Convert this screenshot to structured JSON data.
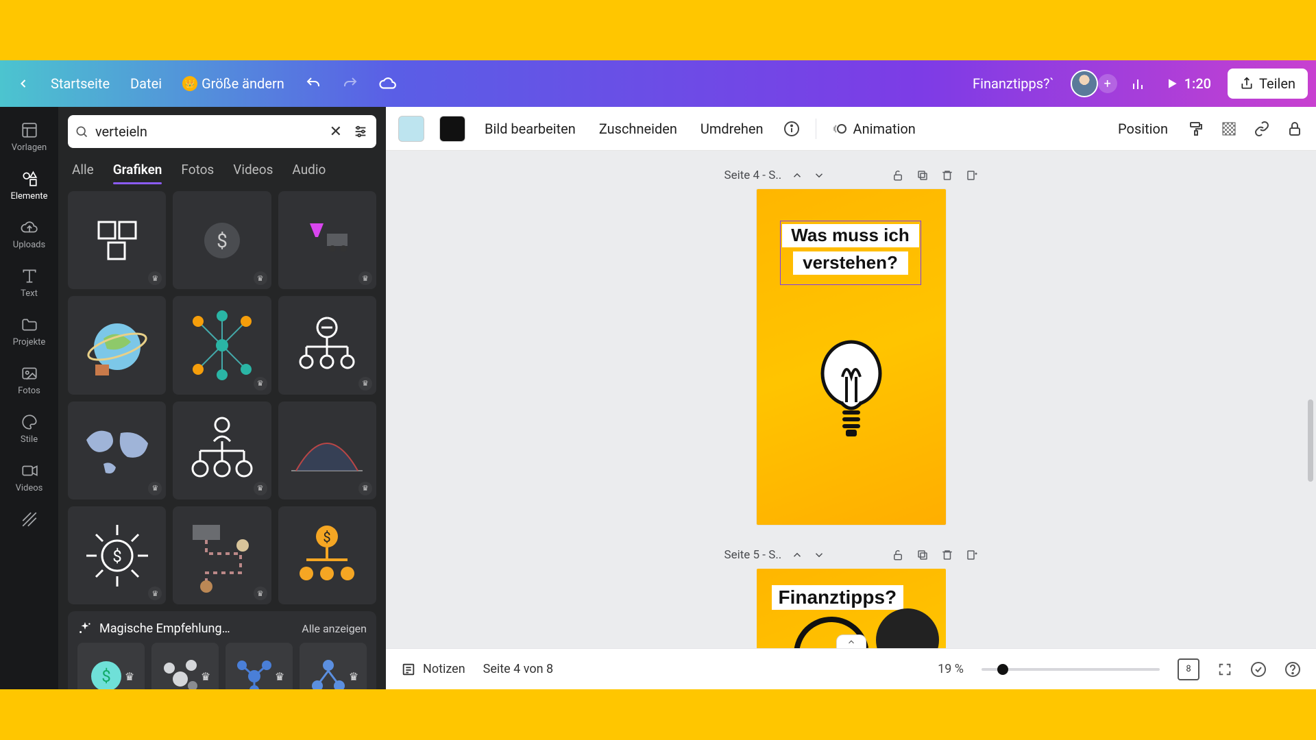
{
  "header": {
    "home": "Startseite",
    "file": "Datei",
    "resize": "Größe ändern",
    "doc_title": "Finanztipps?`",
    "duration": "1:20",
    "share": "Teilen"
  },
  "rail": {
    "templates": "Vorlagen",
    "elements": "Elemente",
    "uploads": "Uploads",
    "text": "Text",
    "projects": "Projekte",
    "photos": "Fotos",
    "styles": "Stile",
    "videos": "Videos"
  },
  "search": {
    "value": "verteieln",
    "tabs": {
      "all": "Alle",
      "graphics": "Grafiken",
      "photos": "Fotos",
      "videos": "Videos",
      "audio": "Audio"
    }
  },
  "magic": {
    "title": "Magische Empfehlung…",
    "show_all": "Alle anzeigen"
  },
  "toolbar2": {
    "edit_image": "Bild bearbeiten",
    "crop": "Zuschneiden",
    "flip": "Umdrehen",
    "animation": "Animation",
    "position": "Position"
  },
  "pages": {
    "p4_label": "Seite 4 - S..",
    "p4_text1": "Was muss ich",
    "p4_text2": "verstehen?",
    "p5_label": "Seite 5 - S..",
    "p5_title": "Finanztipps?"
  },
  "bottombar": {
    "notes": "Notizen",
    "page_of": "Seite 4 von 8",
    "zoom": "19 %",
    "total_pages": "8"
  }
}
